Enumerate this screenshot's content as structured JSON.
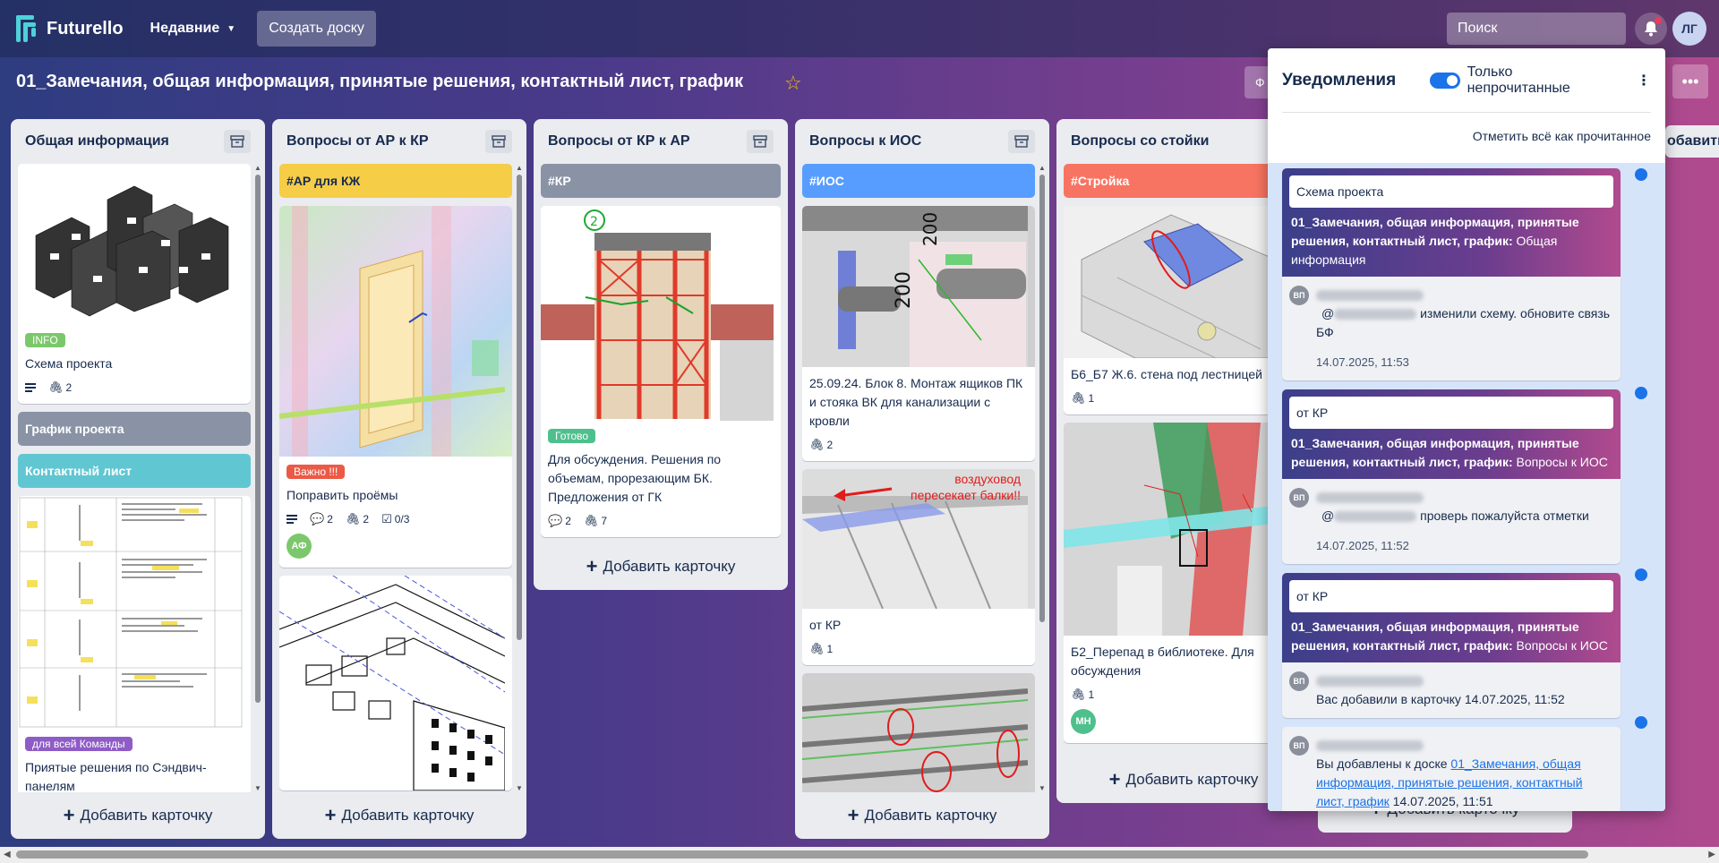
{
  "app": {
    "name": "Futurello",
    "recent": "Недавние",
    "create_board": "Создать доску",
    "search_placeholder": "Поиск",
    "user_initials": "ЛГ"
  },
  "board": {
    "title": "01_Замечания, общая информация, принятые решения, контактный лист, график",
    "filter_label": "Ф"
  },
  "add_card_label": "Добавить карточку",
  "lists": [
    {
      "title": "Общая информация",
      "cards": [
        {
          "label": "INFO",
          "title": "Схема проекта",
          "attachments": "2"
        },
        {
          "color_title": "График проекта"
        },
        {
          "color_title": "Контактный лист"
        },
        {
          "label": "для всей Команды",
          "title": "Приятые решения по Сэндвич-панелям"
        }
      ]
    },
    {
      "title": "Вопросы от АР к КР",
      "cards": [
        {
          "color_title": "#АР для КЖ"
        },
        {
          "label": "Важно !!!",
          "title": "Поправить проёмы",
          "comments": "2",
          "attachments": "2",
          "checklist": "0/3",
          "member": "АФ"
        }
      ]
    },
    {
      "title": "Вопросы от КР к АР",
      "cards": [
        {
          "color_title": "#КР"
        },
        {
          "label": "Готово",
          "title": "Для обсуждения. Решения по объемам, прорезающим БК. Предложения от ГК",
          "comments": "2",
          "attachments": "7"
        }
      ]
    },
    {
      "title": "Вопросы к ИОС",
      "cards": [
        {
          "color_title": "#ИОС"
        },
        {
          "title": "25.09.24. Блок 8. Монтаж ящиков ПК и стояка ВК для канализации с кровли",
          "attachments": "2"
        },
        {
          "title": "от КР",
          "attachments": "1",
          "image_text": "воздуховод пересекает балки!!"
        }
      ]
    },
    {
      "title": "Вопросы со стойки",
      "cards": [
        {
          "color_title": "#Стройка"
        },
        {
          "title": "Б6_Б7 Ж.6. стена под лестницей",
          "attachments": "1"
        },
        {
          "title": "Б2_Перепад в библиотеке. Для обсуждения",
          "attachments": "1",
          "member": "МН"
        }
      ]
    }
  ],
  "notifications": {
    "title": "Уведомления",
    "toggle_label": "Только непрочитанные",
    "mark_all": "Отметить всё как прочитанное",
    "items": [
      {
        "card": "Схема проекта",
        "board": "01_Замечания, общая информация, принятые решения, контактный лист, график:",
        "list": " Общая информация",
        "avatar": "ВП",
        "mention": "@",
        "text": " изменили схему. обновите связь БФ",
        "time": "14.07.2025, 11:53"
      },
      {
        "card": "от КР",
        "board": "01_Замечания, общая информация, принятые решения, контактный лист, график:",
        "list": " Вопросы к ИОС",
        "avatar": "ВП",
        "mention": "@",
        "text": " проверь пожалуйста отметки",
        "time": "14.07.2025, 11:52"
      },
      {
        "card": "от КР",
        "board": "01_Замечания, общая информация, принятые решения, контактный лист, график:",
        "list": " Вопросы к ИОС",
        "avatar": "ВП",
        "text": "Вас добавили в карточку",
        "time": "14.07.2025, 11:52"
      },
      {
        "avatar": "ВП",
        "text": "Вы добавлены к доске ",
        "link": "01_Замечания, общая информация, принятые решения, контактный лист, график",
        "time": "14.07.2025, 11:51"
      }
    ]
  },
  "colors": {
    "info": "#7bc86c",
    "important": "#eb5a46",
    "done": "#4fc08d",
    "team": "#8e5cc6",
    "ar_kzh": "#f5cd47",
    "kr": "#8a93a5",
    "ios": "#579dff",
    "stroika": "#f87462",
    "contact": "#60c6d2",
    "graph": "#8a93a5",
    "member_af": "#7bc86c",
    "member_mn": "#4fc08d"
  }
}
